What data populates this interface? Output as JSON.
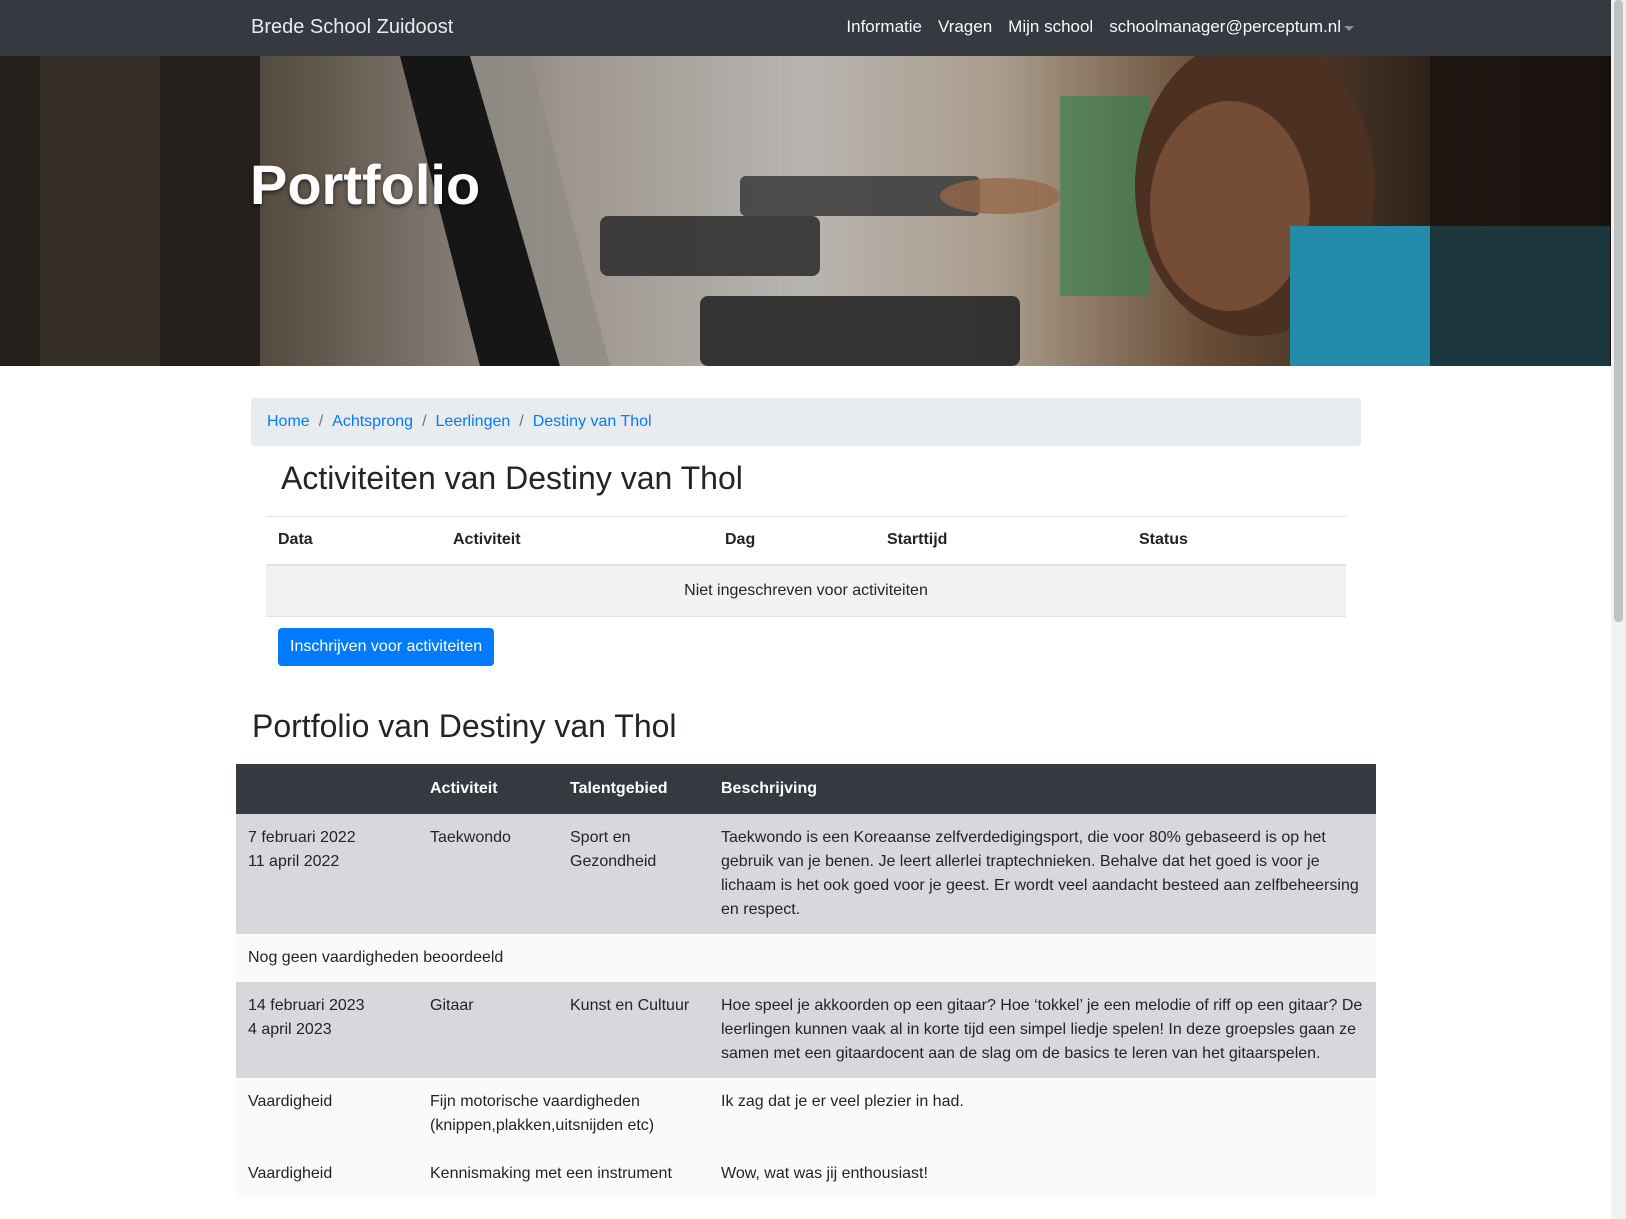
{
  "navbar": {
    "brand": "Brede School Zuidoost",
    "links": [
      "Informatie",
      "Vragen",
      "Mijn school",
      "schoolmanager@perceptum.nl"
    ]
  },
  "hero": {
    "title": "Portfolio"
  },
  "breadcrumb": [
    "Home",
    "Achtsprong",
    "Leerlingen",
    "Destiny van Thol"
  ],
  "activities": {
    "heading": "Activiteiten van Destiny van Thol",
    "columns": [
      "Data",
      "Activiteit",
      "Dag",
      "Starttijd",
      "Status"
    ],
    "empty_message": "Niet ingeschreven voor activiteiten",
    "button_label": "Inschrijven voor activiteiten"
  },
  "portfolio": {
    "heading": "Portfolio van Destiny van Thol",
    "columns": [
      "",
      "Activiteit",
      "Talentgebied",
      "Beschrijving"
    ],
    "entries": [
      {
        "start": "7 februari 2022",
        "end": "11 april 2022",
        "activity": "Taekwondo",
        "area_line1": "Sport en",
        "area_line2": "Gezondheid",
        "description": "Taekwondo is een Koreaanse zelfverdedigingsport, die voor 80% gebaseerd is op het gebruik van je benen. Je leert allerlei traptechnieken. Behalve dat het goed is voor je lichaam is het ook goed voor je geest. Er wordt veel aandacht besteed aan zelfbeheersing en respect.",
        "skills_note": "Nog geen vaardigheden beoordeeld"
      },
      {
        "start": "14 februari 2023",
        "end": "4 april 2023",
        "activity": "Gitaar",
        "area_line1": "Kunst en Cultuur",
        "description": "Hoe speel je akkoorden op een gitaar? Hoe ‘tokkel’ je een melodie of riff op een gitaar? De leerlingen kunnen vaak al in korte tijd een simpel liedje spelen! In deze groepsles gaan ze samen met een gitaardocent aan de slag om de basics te leren van het gitaarspelen.",
        "skills": [
          {
            "label": "Vaardigheid",
            "name": "Fijn motorische vaardigheden (knippen,plakken,uitsnijden etc)",
            "comment": "Ik zag dat je er veel plezier in had."
          },
          {
            "label": "Vaardigheid",
            "name": "Kennismaking met een instrument",
            "comment": "Wow, wat was jij enthousiast!"
          }
        ]
      }
    ]
  },
  "colors": {
    "navbar": "#343a40",
    "primary": "#007bff",
    "breadcrumb_bg": "#e9ecef",
    "table_dark": "#343a40",
    "row_grey": "#d6d8db"
  }
}
